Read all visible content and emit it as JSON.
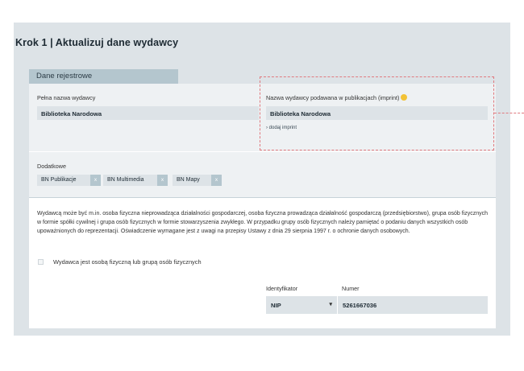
{
  "page": {
    "step_title": "Krok 1 | Aktualizuj dane wydawcy"
  },
  "tab": {
    "label": "Dane rejestrowe"
  },
  "full_name": {
    "label": "Pełna nazwa wydawcy",
    "value": "Biblioteka Narodowa"
  },
  "imprint": {
    "label": "Nazwa wydawcy podawana w publikacjach (imprint)",
    "value": "Biblioteka Narodowa",
    "add_link": "dodaj imprint",
    "info_icon": "info-icon",
    "info_color": "#f2c236"
  },
  "additional": {
    "label": "Dodatkowe",
    "chips": [
      {
        "label": "BN Publikacje",
        "remove": "x"
      },
      {
        "label": "BN Multimedia",
        "remove": "x"
      },
      {
        "label": "BN Mapy",
        "remove": "x"
      }
    ]
  },
  "description": "Wydawcą może być m.in. osoba fizyczna nieprowadząca działalności gospodarczej, osoba fizyczna prowadząca działalność gospodarczą (przedsiębiorstwo), grupa osób fizycznych w formie spółki cywilnej i grupa osób fizycznych w formie stowarzyszenia zwykłego. W przypadku grupy osób fizycznych należy pamiętać o podaniu danych wszystkich osób upoważnionych do reprezentacji. Oświadczenie wymagane jest z uwagi na przepisy Ustawy z dnia 29 sierpnia 1997 r. o ochronie danych osobowych.",
  "checkbox": {
    "label": "Wydawca jest osobą fizyczną lub grupą osób fizycznych",
    "checked": false
  },
  "identifier": {
    "label": "Identyfikator",
    "selected": "NIP",
    "caret": "▾"
  },
  "number": {
    "label": "Numer",
    "value": "5261667036"
  },
  "colors": {
    "panel": "#dde3e7",
    "tab": "#b4c6ce",
    "highlight": "#e07a7f"
  }
}
